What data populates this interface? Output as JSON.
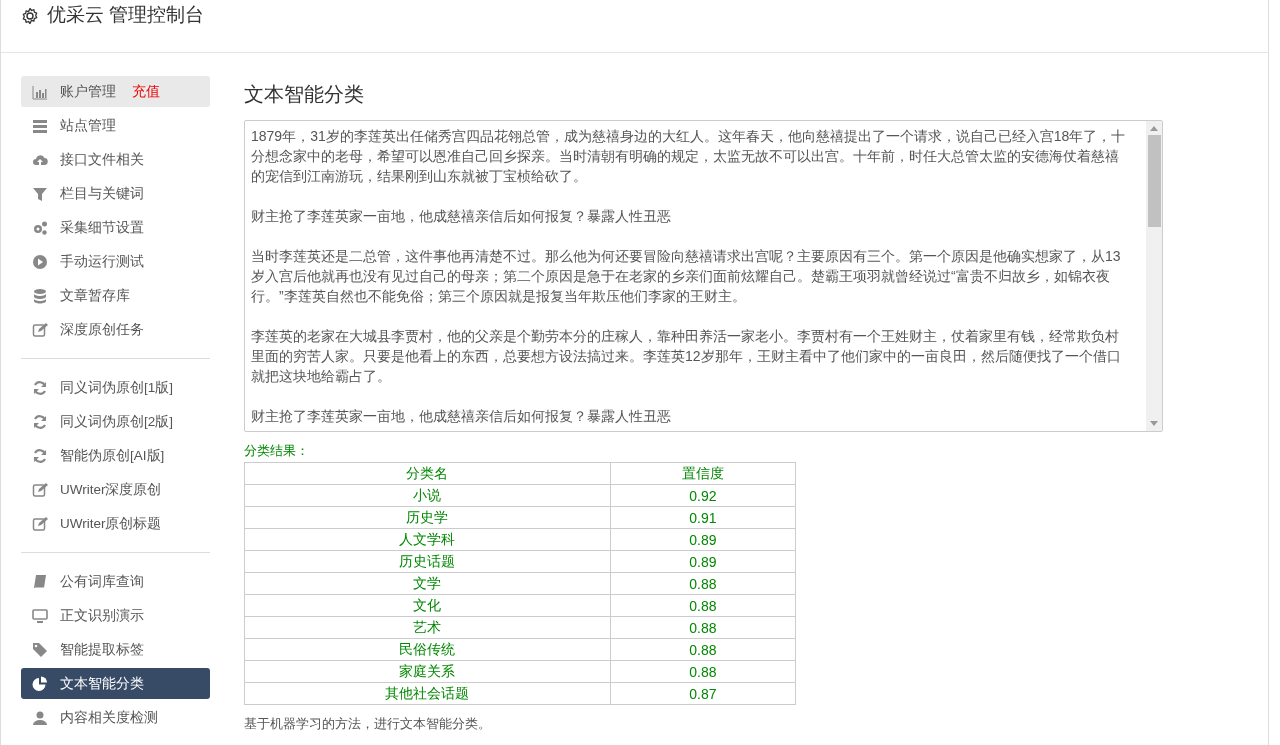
{
  "header": {
    "title": "优采云 管理控制台"
  },
  "sidebar": {
    "groups": [
      [
        {
          "label": "账户管理",
          "badge": "充值",
          "highlighted": true,
          "selected": false
        },
        {
          "label": "站点管理",
          "highlighted": false,
          "selected": false
        },
        {
          "label": "接口文件相关",
          "highlighted": false,
          "selected": false
        },
        {
          "label": "栏目与关键词",
          "highlighted": false,
          "selected": false
        },
        {
          "label": "采集细节设置",
          "highlighted": false,
          "selected": false
        },
        {
          "label": "手动运行测试",
          "highlighted": false,
          "selected": false
        },
        {
          "label": "文章暂存库",
          "highlighted": false,
          "selected": false
        },
        {
          "label": "深度原创任务",
          "highlighted": false,
          "selected": false
        }
      ],
      [
        {
          "label": "同义词伪原创[1版]",
          "highlighted": false,
          "selected": false
        },
        {
          "label": "同义词伪原创[2版]",
          "highlighted": false,
          "selected": false
        },
        {
          "label": "智能伪原创[AI版]",
          "highlighted": false,
          "selected": false
        },
        {
          "label": "UWriter深度原创",
          "highlighted": false,
          "selected": false
        },
        {
          "label": "UWriter原创标题",
          "highlighted": false,
          "selected": false
        }
      ],
      [
        {
          "label": "公有词库查询",
          "highlighted": false,
          "selected": false
        },
        {
          "label": "正文识别演示",
          "highlighted": false,
          "selected": false
        },
        {
          "label": "智能提取标签",
          "highlighted": false,
          "selected": false
        },
        {
          "label": "文本智能分类",
          "highlighted": false,
          "selected": true
        },
        {
          "label": "内容相关度检测",
          "highlighted": false,
          "selected": false
        }
      ]
    ]
  },
  "main": {
    "title": "文本智能分类",
    "text_input": {
      "paragraphs": [
        "1879年，31岁的李莲英出任储秀宫四品花翎总管，成为慈禧身边的大红人。这年春天，他向慈禧提出了一个请求，说自己已经入宫18年了，十分想念家中的老母，希望可以恩准自己回乡探亲。当时清朝有明确的规定，太监无故不可以出宫。十年前，时任大总管太监的安德海仗着慈禧的宠信到江南游玩，结果刚到山东就被丁宝桢给砍了。",
        "财主抢了李莲英家一亩地，他成慈禧亲信后如何报复？暴露人性丑恶",
        "当时李莲英还是二总管，这件事他再清楚不过。那么他为何还要冒险向慈禧请求出宫呢？主要原因有三个。第一个原因是他确实想家了，从13岁入宫后他就再也没有见过自己的母亲；第二个原因是急于在老家的乡亲们面前炫耀自己。楚霸王项羽就曾经说过“富贵不归故乡，如锦衣夜行。”李莲英自然也不能免俗；第三个原因就是报复当年欺压他们李家的王财主。",
        "李莲英的老家在大城县李贾村，他的父亲是个勤劳本分的庄稼人，靠种田养活一家老小。李贾村有一个王姓财主，仗着家里有钱，经常欺负村里面的穷苦人家。只要是他看上的东西，总要想方设法搞过来。李莲英12岁那年，王财主看中了他们家中的一亩良田，然后随便找了一个借口就把这块地给霸占了。",
        "财主抢了李莲英家一亩地，他成慈禧亲信后如何报复？暴露人性丑恶"
      ]
    },
    "result_label": "分类结果：",
    "table": {
      "columns": [
        "分类名",
        "置信度"
      ],
      "rows": [
        [
          "小说",
          "0.92"
        ],
        [
          "历史学",
          "0.91"
        ],
        [
          "人文学科",
          "0.89"
        ],
        [
          "历史话题",
          "0.89"
        ],
        [
          "文学",
          "0.88"
        ],
        [
          "文化",
          "0.88"
        ],
        [
          "艺术",
          "0.88"
        ],
        [
          "民俗传统",
          "0.88"
        ],
        [
          "家庭关系",
          "0.88"
        ],
        [
          "其他社会话题",
          "0.87"
        ]
      ]
    },
    "note": "基于机器学习的方法，进行文本智能分类。"
  }
}
